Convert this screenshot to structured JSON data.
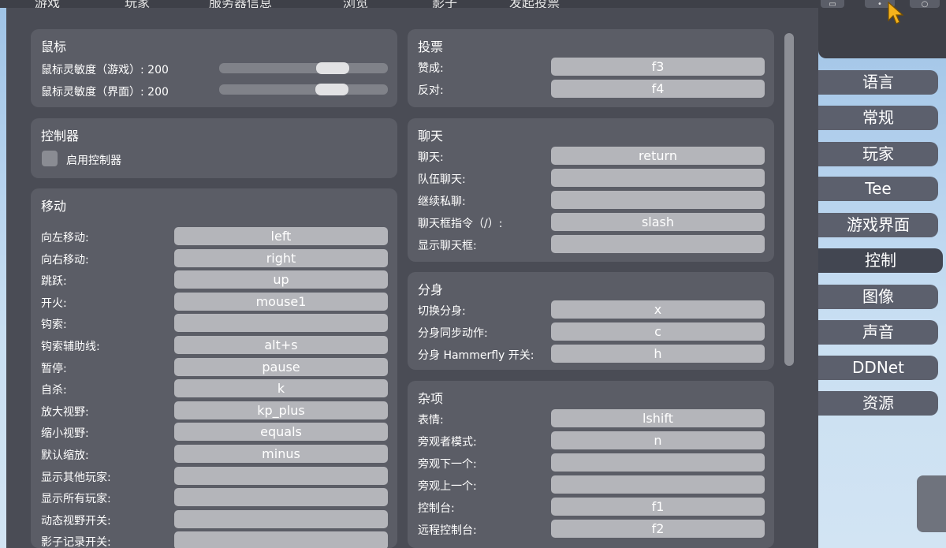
{
  "topnav": [
    "游戏",
    "玩家",
    "服务器信息",
    "浏览",
    "影子",
    "发起投票"
  ],
  "tabs": [
    "语言",
    "常规",
    "玩家",
    "Tee",
    "游戏界面",
    "控制",
    "图像",
    "声音",
    "DDNet",
    "资源"
  ],
  "active_tab": "控制",
  "mouse": {
    "title": "鼠标",
    "rows": [
      {
        "label": "鼠标灵敏度（游戏）: 200",
        "level": 0.62
      },
      {
        "label": "鼠标灵敏度（界面）: 200",
        "level": 0.6
      }
    ]
  },
  "controller": {
    "title": "控制器",
    "checkbox_label": "启用控制器"
  },
  "movement": {
    "title": "移动",
    "rows": [
      {
        "label": "向左移动:",
        "key": "left"
      },
      {
        "label": "向右移动:",
        "key": "right"
      },
      {
        "label": "跳跃:",
        "key": "up"
      },
      {
        "label": "开火:",
        "key": "mouse1"
      },
      {
        "label": "钩索:",
        "key": ""
      },
      {
        "label": "钩索辅助线:",
        "key": "alt+s"
      },
      {
        "label": "暂停:",
        "key": "pause"
      },
      {
        "label": "自杀:",
        "key": "k"
      },
      {
        "label": "放大视野:",
        "key": "kp_plus"
      },
      {
        "label": "缩小视野:",
        "key": "equals"
      },
      {
        "label": "默认缩放:",
        "key": "minus"
      },
      {
        "label": "显示其他玩家:",
        "key": ""
      },
      {
        "label": "显示所有玩家:",
        "key": ""
      },
      {
        "label": "动态视野开关:",
        "key": ""
      },
      {
        "label": "影子记录开关:",
        "key": ""
      }
    ]
  },
  "vote": {
    "title": "投票",
    "rows": [
      {
        "label": "赞成:",
        "key": "f3"
      },
      {
        "label": "反对:",
        "key": "f4"
      }
    ]
  },
  "chat": {
    "title": "聊天",
    "rows": [
      {
        "label": "聊天:",
        "key": "return"
      },
      {
        "label": "队伍聊天:",
        "key": ""
      },
      {
        "label": "继续私聊:",
        "key": ""
      },
      {
        "label": "聊天框指令（/）:",
        "key": "slash"
      },
      {
        "label": "显示聊天框:",
        "key": ""
      }
    ]
  },
  "dummy": {
    "title": "分身",
    "rows": [
      {
        "label": "切换分身:",
        "key": "x"
      },
      {
        "label": "分身同步动作:",
        "key": "c"
      },
      {
        "label": "分身 Hammerfly 开关:",
        "key": "h"
      }
    ]
  },
  "misc": {
    "title": "杂项",
    "rows": [
      {
        "label": "表情:",
        "key": "lshift"
      },
      {
        "label": "旁观者模式:",
        "key": "n"
      },
      {
        "label": "旁观下一个:",
        "key": ""
      },
      {
        "label": "旁观上一个:",
        "key": ""
      },
      {
        "label": "控制台:",
        "key": "f1"
      },
      {
        "label": "远程控制台:",
        "key": "f2"
      }
    ]
  }
}
